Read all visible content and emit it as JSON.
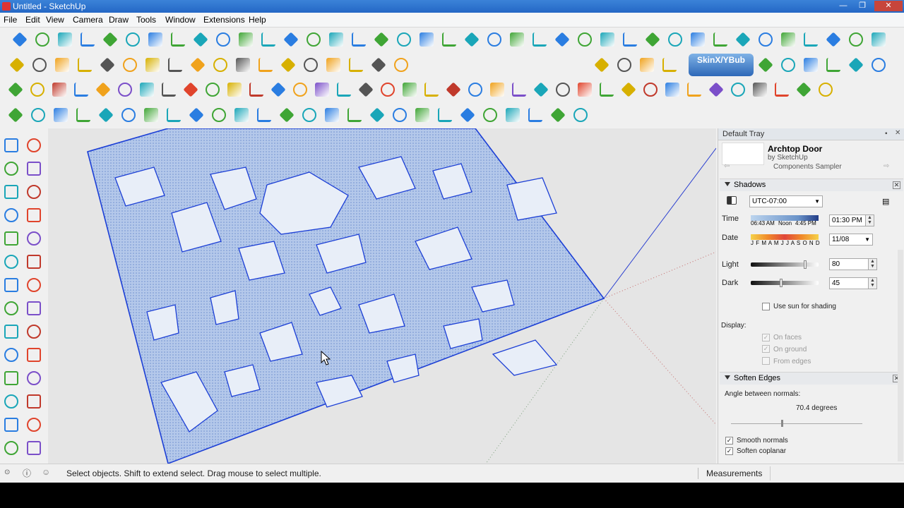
{
  "window": {
    "title": "Untitled - SketchUp",
    "min": "—",
    "max": "❐",
    "close": "✕"
  },
  "menu": [
    "File",
    "Edit",
    "View",
    "Camera",
    "Draw",
    "Tools",
    "Window",
    "Extensions",
    "Help"
  ],
  "toolbar": {
    "skin_label": "SkinX/YBub"
  },
  "tray": {
    "title": "Default Tray",
    "component": {
      "name": "Archtop Door",
      "author": "by SketchUp",
      "sampler": "Components Sampler"
    },
    "shadows": {
      "title": "Shadows",
      "timezone": "UTC-07:00",
      "time_label": "Time",
      "time_start": "06:43 AM",
      "time_noon": "Noon",
      "time_end": "4:45 PM",
      "time_value": "01:30 PM",
      "date_label": "Date",
      "months": "J F M A M J J A S O N D",
      "date_value": "11/08",
      "light_label": "Light",
      "light_value": "80",
      "light_level": 0.8,
      "dark_label": "Dark",
      "dark_value": "45",
      "dark_level": 0.45,
      "use_sun": "Use sun for shading",
      "display_label": "Display:",
      "on_faces": "On faces",
      "on_ground": "On ground",
      "from_edges": "From edges"
    },
    "soften": {
      "title": "Soften Edges",
      "angle_label": "Angle between normals:",
      "angle_value": "70.4  degrees",
      "angle_level": 0.39,
      "smooth": "Smooth normals",
      "coplanar": "Soften coplanar"
    }
  },
  "status": {
    "hint": "Select objects. Shift to extend select. Drag mouse to select multiple.",
    "measurements": "Measurements"
  },
  "colors": {
    "selection_blue": "#1c3fd6",
    "face_fill": "#a8c0e6",
    "title_blue": "#2f78d2"
  }
}
